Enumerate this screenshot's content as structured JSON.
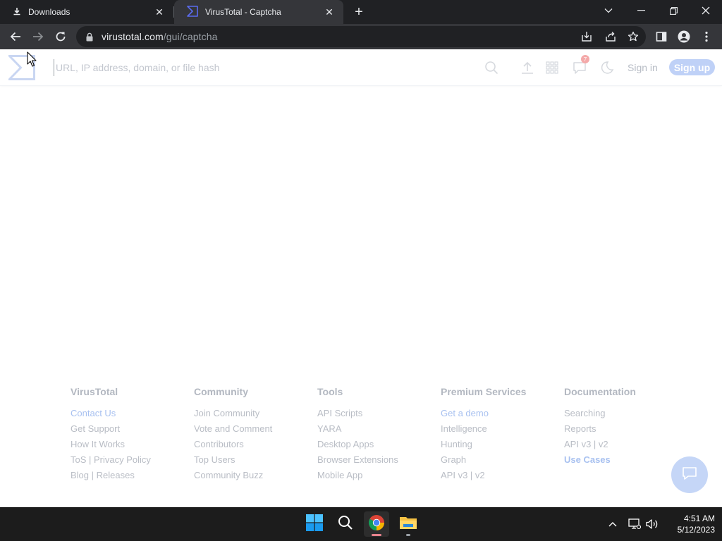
{
  "browser": {
    "tabs": [
      {
        "title": "Downloads",
        "icon": "download-icon",
        "active": false
      },
      {
        "title": "VirusTotal - Captcha",
        "icon": "virustotal-icon",
        "active": true
      }
    ],
    "new_tab_label": "+",
    "url_host": "virustotal.com",
    "url_path": "/gui/captcha"
  },
  "header": {
    "search_placeholder": "URL, IP address, domain, or file hash",
    "notification_count": "7",
    "signin_label": "Sign in",
    "signup_label": "Sign up"
  },
  "footer": {
    "columns": [
      {
        "title": "VirusTotal",
        "links": [
          "Contact Us",
          "Get Support",
          "How It Works",
          "ToS | Privacy Policy",
          "Blog | Releases"
        ]
      },
      {
        "title": "Community",
        "links": [
          "Join Community",
          "Vote and Comment",
          "Contributors",
          "Top Users",
          "Community Buzz"
        ]
      },
      {
        "title": "Tools",
        "links": [
          "API Scripts",
          "YARA",
          "Desktop Apps",
          "Browser Extensions",
          "Mobile App"
        ]
      },
      {
        "title": "Premium Services",
        "links": [
          "Get a demo",
          "Intelligence",
          "Hunting",
          "Graph",
          "API v3 | v2"
        ]
      },
      {
        "title": "Documentation",
        "links": [
          "Searching",
          "Reports",
          "API v3 | v2",
          "Use Cases"
        ]
      }
    ]
  },
  "taskbar": {
    "time": "4:51 AM",
    "date": "5/12/2023"
  },
  "colors": {
    "accent": "#bfd1f7",
    "link_highlight": "#a8c1f0",
    "chrome_dark": "#202124",
    "chrome_toolbar": "#35363a"
  }
}
